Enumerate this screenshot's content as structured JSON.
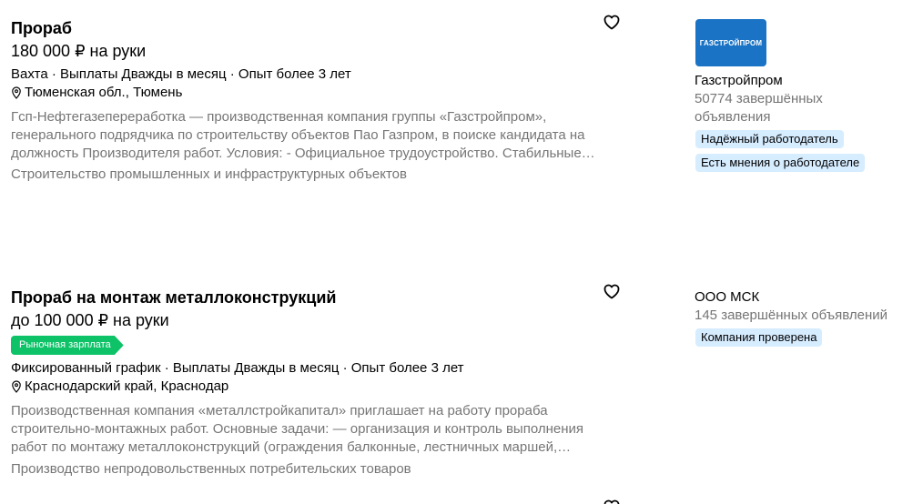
{
  "vacancies": [
    {
      "title": "Прораб",
      "salary": "180 000 ₽ на руки",
      "params": "Вахта · Выплаты Дважды в месяц · Опыт более 3 лет",
      "location": "Тюменская обл., Тюмень",
      "description_lines": [
        "Гсп-Нефтегазепереработка — производственная компания группы «Газстройпром»,",
        "генерального подрядчика по строительству объектов Пао Газпром, в поиске кандидата на",
        "должность Производителя работ. Условия: - Официальное трудоустройство. Стабильные…"
      ],
      "category": "Строительство промышленных и инфраструктурных объектов",
      "company": {
        "logo_text": "ГАЗСТРОЙПРОМ",
        "name": "Газстройпром",
        "stats_line1": "50774 завершённых",
        "stats_line2": "объявления",
        "badges": [
          "Надёжный работодатель",
          "Есть мнения о работодателе"
        ]
      }
    },
    {
      "title": "Прораб на монтаж металлоконструкций",
      "salary": "до 100 000 ₽ на руки",
      "salary_tag": "Рыночная зарплата",
      "params": "Фиксированный график · Выплаты Дважды в месяц · Опыт более 3 лет",
      "location": "Краснодарский край, Краснодар",
      "description_lines": [
        "Производственная компания «металлстройкапитал» приглашает на работу прораба",
        "строительно-монтажных работ. Основные задачи: — организация и контроль выполнения",
        "работ по монтажу металлоконструкций (ограждения балконные, лестничных маршей,…"
      ],
      "category": "Производство непродовольственных потребительских товаров",
      "company": {
        "name": "ООО МСК",
        "stats_line1": "145 завершённых объявлений",
        "badges": [
          "Компания проверена"
        ]
      }
    }
  ],
  "colors": {
    "muted_text": "#757575",
    "badge_bg": "#d6ecff",
    "market_tag_bg": "#0dc267",
    "logo_bg": "#1a73c4"
  },
  "icons": {
    "favorite": "heart-icon",
    "location": "map-pin-icon"
  }
}
